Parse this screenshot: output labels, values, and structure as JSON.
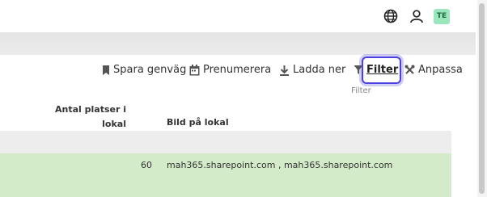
{
  "topbar": {
    "icons": [
      "globe-icon",
      "user-icon"
    ],
    "avatar_initials": "TE"
  },
  "toolbar": {
    "save_shortcut": "Spara genväg",
    "subscribe": "Prenumerera",
    "download": "Ladda ner",
    "filter": "Filter",
    "customize": "Anpassa",
    "tooltip": "Filter"
  },
  "table": {
    "headers": [
      "Antal platser i lokal",
      "Bild på lokal"
    ],
    "header_line1": "Antal platser i",
    "header_line2": "lokal",
    "rows": [
      {
        "seats": "60",
        "image": "mah365.sharepoint.com , mah365.sharepoint.com"
      }
    ]
  },
  "colors": {
    "accent_focus": "#4b3fe0",
    "row_highlight": "#d4ebc9",
    "avatar_bg": "#9be6bd"
  }
}
